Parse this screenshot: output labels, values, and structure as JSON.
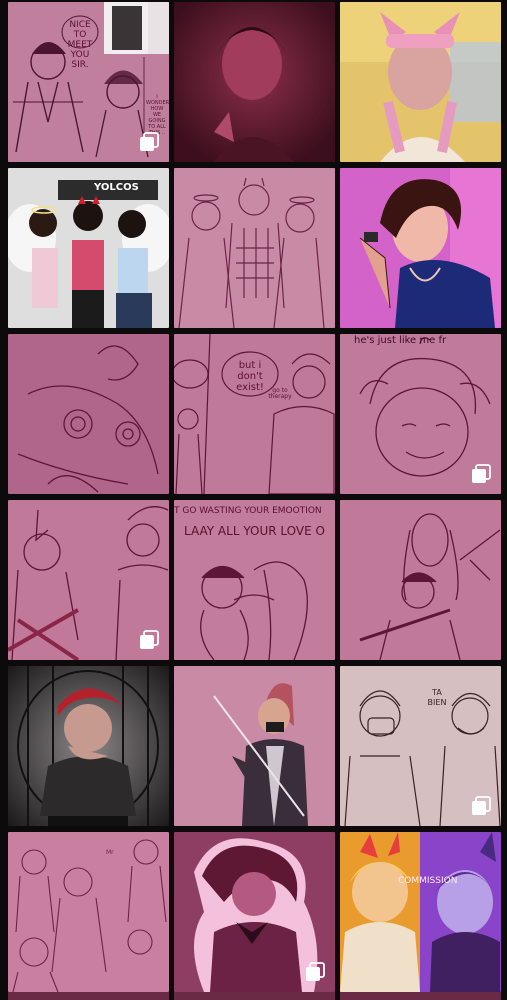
{
  "texts": {
    "t1_bubble": "NICE TO MEET YOU SIR.",
    "t1_note": "I WONDER HOW WE GOING TO ALL THIS ..",
    "t4_sign": "YOLCOS",
    "t8_bubble": "but i don't exist!",
    "t8_small": "go to therapy",
    "t9_top": "he's just like me fr",
    "t11_top": "T GO WASTING YOUR EMOOTION",
    "t11_mid": "LAAY ALL YOUR LOVE O",
    "t15_bubble": "TA BIEN",
    "t18_banner": "COMMISSION"
  },
  "tiles": [
    {
      "name": "tile-sketch-meeting",
      "bg": "#c17f9e",
      "multi": true
    },
    {
      "name": "tile-dark-portrait",
      "bg": "#5a1a2c",
      "multi": false
    },
    {
      "name": "tile-color-headband",
      "bg": "#e7c56a",
      "multi": false
    },
    {
      "name": "tile-photo-angels",
      "bg": "#dcdcdc",
      "multi": false
    },
    {
      "name": "tile-sketch-trio",
      "bg": "#c98aa6",
      "multi": false
    },
    {
      "name": "tile-color-boy-curls",
      "bg": "#d05cc9",
      "multi": false
    },
    {
      "name": "tile-sketch-shoulder",
      "bg": "#b0668a",
      "multi": false
    },
    {
      "name": "tile-sketch-dont-exist",
      "bg": "#bf7a99",
      "multi": false
    },
    {
      "name": "tile-sketch-smiling",
      "bg": "#c07a9a",
      "multi": true
    },
    {
      "name": "tile-sketch-horned",
      "bg": "#c07999",
      "multi": true
    },
    {
      "name": "tile-sketch-lyrics",
      "bg": "#c27d9c",
      "multi": false
    },
    {
      "name": "tile-sketch-sword-pair",
      "bg": "#c07999",
      "multi": false
    },
    {
      "name": "tile-color-red-hair",
      "bg": "#3b3538",
      "multi": false
    },
    {
      "name": "tile-color-swordsman",
      "bg": "#c98aa6",
      "multi": false
    },
    {
      "name": "tile-sketch-masked",
      "bg": "#d5bebf",
      "multi": true
    },
    {
      "name": "tile-sketch-group",
      "bg": "#c87fa0",
      "multi": false
    },
    {
      "name": "tile-color-outline-boy",
      "bg": "#8e3d63",
      "multi": true
    },
    {
      "name": "tile-color-commission",
      "bg": "#e79a2e",
      "multi": false
    }
  ]
}
